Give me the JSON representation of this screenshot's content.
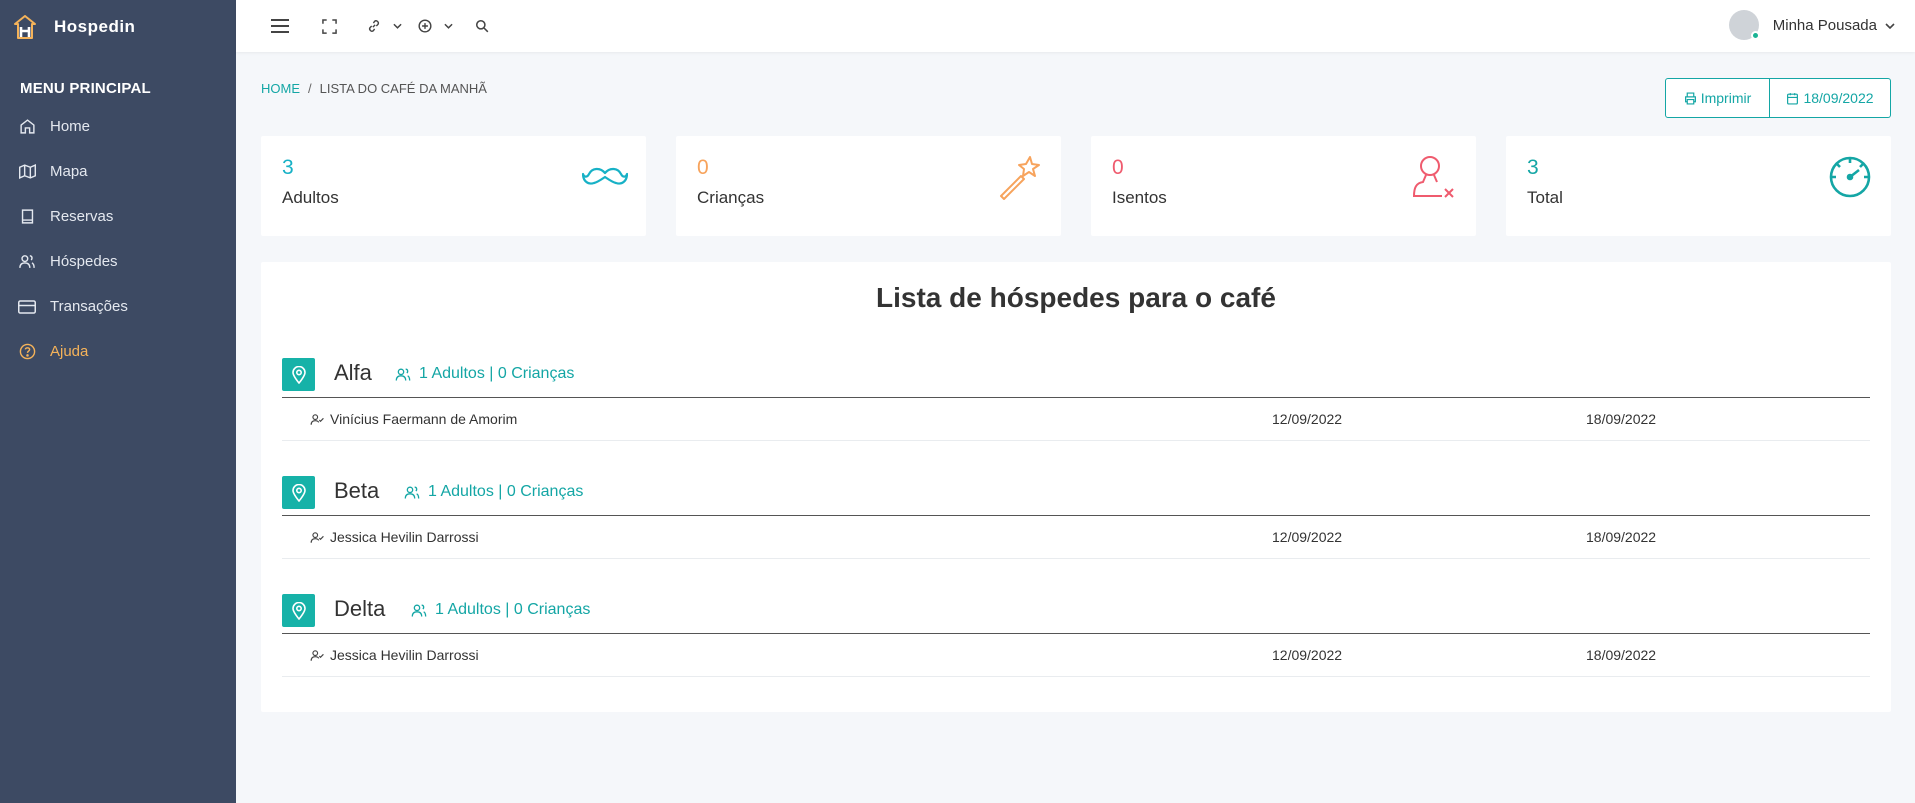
{
  "app": {
    "name": "Hospedin"
  },
  "sidebar": {
    "menu_title": "MENU PRINCIPAL",
    "items": [
      {
        "label": "Home",
        "icon": "home-icon"
      },
      {
        "label": "Mapa",
        "icon": "map-icon"
      },
      {
        "label": "Reservas",
        "icon": "book-icon"
      },
      {
        "label": "Hóspedes",
        "icon": "users-icon"
      },
      {
        "label": "Transações",
        "icon": "credit-card-icon"
      },
      {
        "label": "Ajuda",
        "icon": "help-circle-icon"
      }
    ]
  },
  "topbar": {
    "user_name": "Minha Pousada"
  },
  "breadcrumb": {
    "home": "HOME",
    "separator": "/",
    "current": "LISTA DO CAFÉ DA MANHÃ"
  },
  "actions": {
    "print_label": "Imprimir",
    "date_label": "18/09/2022"
  },
  "stats": [
    {
      "value": "3",
      "label": "Adultos",
      "color": "#17b1c6",
      "icon": "mustache-icon"
    },
    {
      "value": "0",
      "label": "Crianças",
      "color": "#f7a35c",
      "icon": "magic-wand-icon"
    },
    {
      "value": "0",
      "label": "Isentos",
      "color": "#ef5b6e",
      "icon": "user-x-icon"
    },
    {
      "value": "3",
      "label": "Total",
      "color": "#14a6a5",
      "icon": "speedometer-icon"
    }
  ],
  "list": {
    "title": "Lista de hóspedes para o café",
    "groups": [
      {
        "name": "Alfa",
        "count": "1 Adultos | 0 Crianças",
        "guests": [
          {
            "name": "Vinícius Faermann de Amorim",
            "check_in": "12/09/2022",
            "check_out": "18/09/2022"
          }
        ]
      },
      {
        "name": "Beta",
        "count": "1 Adultos | 0 Crianças",
        "guests": [
          {
            "name": "Jessica Hevilin Darrossi",
            "check_in": "12/09/2022",
            "check_out": "18/09/2022"
          }
        ]
      },
      {
        "name": "Delta",
        "count": "1 Adultos | 0 Crianças",
        "guests": [
          {
            "name": "Jessica Hevilin Darrossi",
            "check_in": "12/09/2022",
            "check_out": "18/09/2022"
          }
        ]
      }
    ]
  },
  "colors": {
    "accent": "#14a6a5",
    "sidebar": "#3d4a63",
    "help": "#f5b35a"
  }
}
